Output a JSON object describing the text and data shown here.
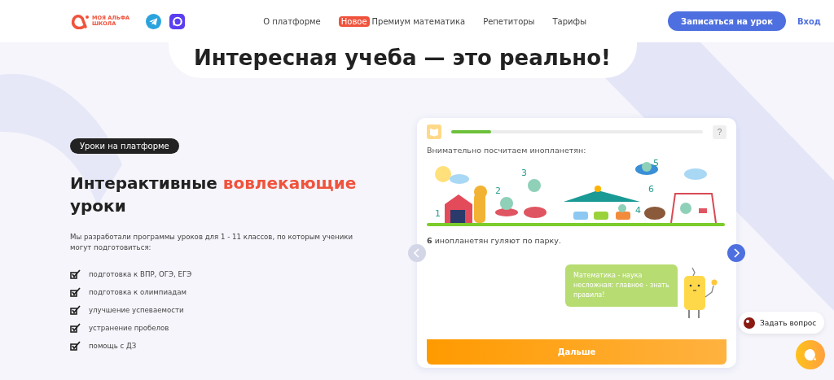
{
  "header": {
    "logo_lines": [
      "МОЯ АЛЬФА",
      "ШКОЛА"
    ],
    "nav": [
      {
        "label": "О платформе"
      },
      {
        "label": "Премиум математика",
        "badge": "Новое"
      },
      {
        "label": "Репетиторы"
      },
      {
        "label": "Тарифы"
      }
    ],
    "cta": "Записаться на урок",
    "login": "Вход"
  },
  "hero_title": "Интересная учеба — это реально!",
  "section": {
    "tag": "Уроки на платформе",
    "heading": {
      "text": "Интерактивные",
      "accent": "вовлекающие",
      "rest": "уроки"
    },
    "description": "Мы разработали программы уроков для 1 - 11 классов, по которым ученики могут подготовиться:",
    "checklist": [
      "подготовка к ВПР, ОГЭ, ЕГЭ",
      "подготовка к олимпиадам",
      "улучшение успеваемости",
      "устранение пробелов",
      "помощь с ДЗ"
    ]
  },
  "lesson": {
    "progress": {
      "level": 0.16
    },
    "help": "?",
    "question": "Внимательно посчитаем инопланетян:",
    "illustration_numbers": [
      "1",
      "2",
      "3",
      "4",
      "5",
      "6"
    ],
    "answer": "**6** инопланетян гуляют по парку.",
    "prev": {
      "disabled": true
    },
    "next": {
      "disabled": false
    },
    "bubble": "Математика - наука несложная: главное - знать правила!",
    "button": "Дальше"
  },
  "chat": {
    "label": "Задать вопрос"
  }
}
